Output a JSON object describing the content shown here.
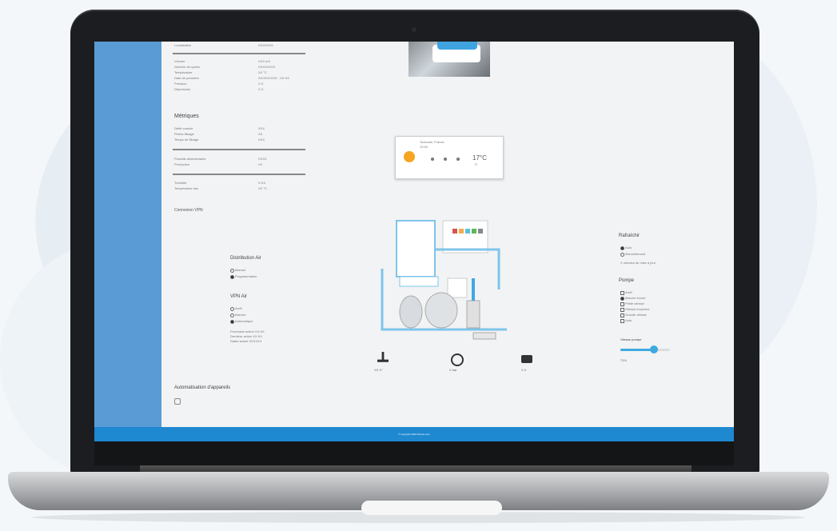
{
  "footer": {
    "copyright": "© copyright 2022 Piscine.com"
  },
  "left_panel": {
    "top_label": "Localisation",
    "top_value": "XXXXXXX",
    "details": [
      {
        "label": "Volume",
        "value": "XXX m3"
      },
      {
        "label": "Nombre de cycles",
        "value": "XXXXXXXX"
      },
      {
        "label": "Température",
        "value": "XX °C"
      },
      {
        "label": "Date de première",
        "value": "XX/XX/XXXX - XX:XX"
      },
      {
        "label": "Pression",
        "value": "X.X"
      },
      {
        "label": "Dépression",
        "value": "X.X"
      }
    ],
    "section_title": "Métriques",
    "metrics": [
      {
        "label": "Débit cumulé",
        "value": "XXX"
      },
      {
        "label": "Pertes filtrage",
        "value": "XX"
      },
      {
        "label": "Temps de filtrage",
        "value": "XXX"
      }
    ],
    "metrics2": [
      {
        "label": "Produits désinfectants",
        "value": "XXXX"
      },
      {
        "label": "Production",
        "value": "XX"
      }
    ],
    "metrics3": [
      {
        "label": "Turbidité",
        "value": "X.XX"
      },
      {
        "label": "Température eau",
        "value": "XX °C"
      }
    ],
    "subtitle": "Connexion VPN"
  },
  "distribution": {
    "title": "Distribution Air",
    "option_a": "Manuel",
    "option_b": "Programmation"
  },
  "vpn": {
    "title": "VPN Air",
    "option_a": "Arrêt",
    "option_b": "Marche",
    "option_c": "Automatique",
    "note_1": "Prochaine action XX:XX",
    "note_2": "Dernière action XX:XX",
    "note_3": "Statut actuel XXXXXX"
  },
  "auto": {
    "title": "Automatisation d'appareils"
  },
  "weather": {
    "location": "Toulouse, France",
    "time": "12:00",
    "temp": "17°C",
    "sub": "°C"
  },
  "metrics_bar": [
    {
      "icon": "thermometer-icon",
      "value": "XX.X°"
    },
    {
      "icon": "gauge-icon",
      "value": "X bar"
    },
    {
      "icon": "pump-icon",
      "value": "X.X"
    }
  ],
  "right_panel": {
    "refresh_title": "Rafraîchir",
    "refresh_a": "Auto",
    "refresh_b": "Manuellement",
    "refresh_note": "X minutes de mise à jour",
    "pump_title": "Pompe",
    "pump_options": [
      "Arrêt",
      "Marche forcée",
      "Petite vitesse",
      "Vitesse moyenne",
      "Grande vitesse",
      "Auto"
    ],
    "speed_title": "Vitesse pompe",
    "speed_value": "75%",
    "speed_level": 0.68
  },
  "colors": {
    "sidebar": "#5b9bd5",
    "footer": "#1e88d0",
    "accent": "#3fa9e0"
  }
}
